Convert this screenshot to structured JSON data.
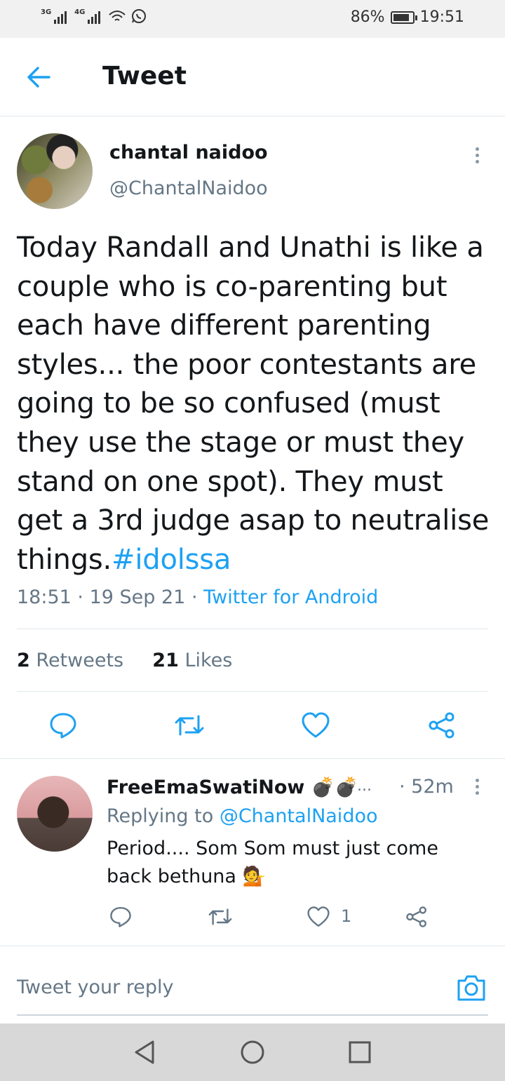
{
  "status_bar": {
    "net1": "3G",
    "net2": "4G",
    "battery": "86%",
    "battery_level": 0.86,
    "time": "19:51"
  },
  "header": {
    "title": "Tweet"
  },
  "tweet": {
    "author_name": "chantal naidoo",
    "author_handle": "@ChantalNaidoo",
    "text": "Today Randall and Unathi is like a couple who is co-parenting but each have different parenting styles... the poor contestants are going to be so confused (must they use the stage or must they stand on one spot). They must get a 3rd judge asap to neutralise things.",
    "hashtag": "#idolssa",
    "time": "18:51",
    "date": "19 Sep 21",
    "source": "Twitter for Android",
    "retweets_count": "2",
    "retweets_label": "Retweets",
    "likes_count": "21",
    "likes_label": "Likes"
  },
  "reply": {
    "author_name": "FreeEmaSwatiNow",
    "name_emoji": "💣💣",
    "more": "...",
    "time": "· 52m",
    "replying_prefix": "Replying to",
    "replying_handle": "@ChantalNaidoo",
    "text": "Period.... Som Som must just come back bethuna",
    "text_emoji": "💁",
    "like_count": "1"
  },
  "composer": {
    "placeholder": "Tweet your reply"
  },
  "icons": {
    "back": "arrow-left-icon",
    "more": "more-vertical-icon",
    "reply": "comment-icon",
    "retweet": "retweet-icon",
    "like": "heart-icon",
    "share": "share-icon",
    "camera": "camera-icon",
    "nav_back": "triangle-back-icon",
    "nav_home": "circle-home-icon",
    "nav_recent": "square-recents-icon"
  },
  "colors": {
    "accent": "#1da1f2",
    "secondary_text": "#657786",
    "primary_text": "#14171a"
  }
}
